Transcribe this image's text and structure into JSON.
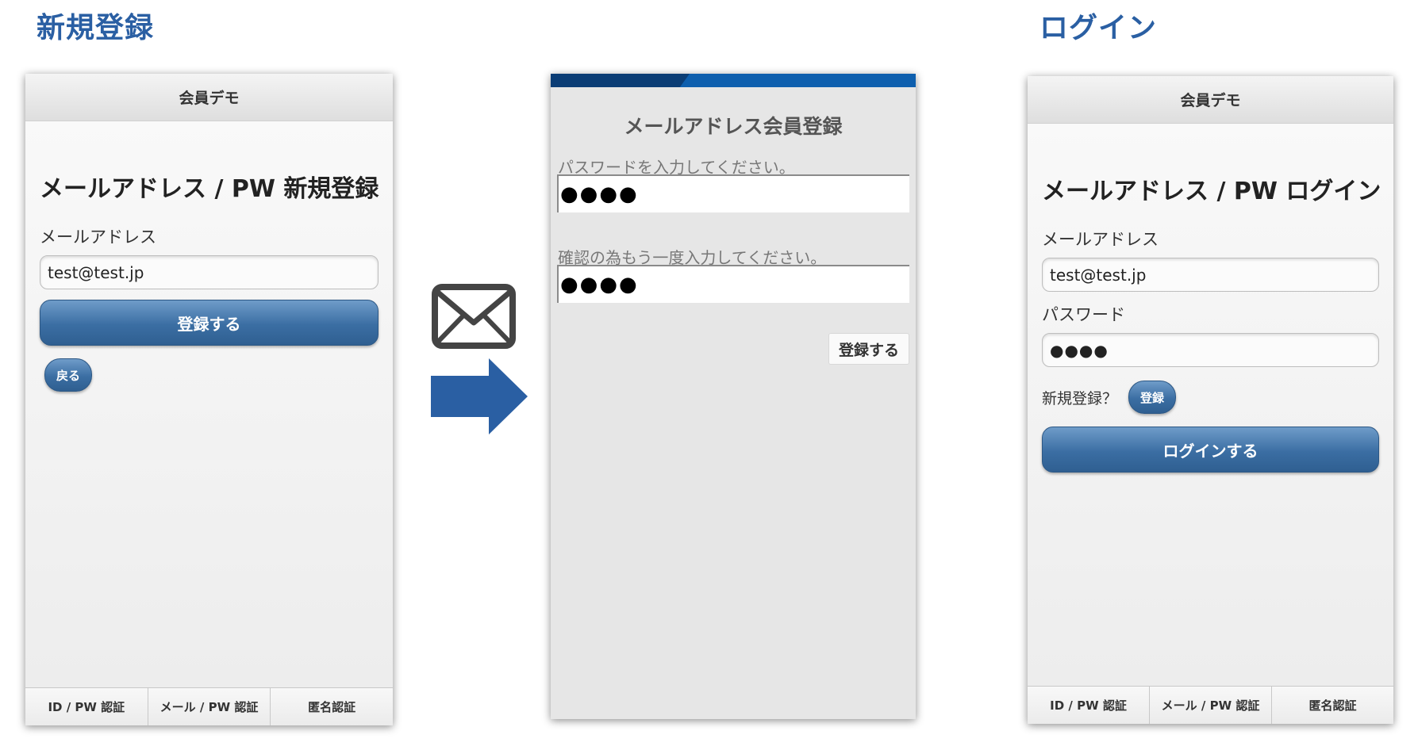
{
  "sections": {
    "register_title": "新規登録",
    "login_title": "ログイン"
  },
  "colors": {
    "accent_blue": "#2a5fa3",
    "button_blue": "#3b6ea3",
    "arrow_blue": "#2a5fa3"
  },
  "register_screen": {
    "header": "会員デモ",
    "heading": "メールアドレス / PW 新規登録",
    "email_label": "メールアドレス",
    "email_value": "test@test.jp",
    "submit_label": "登録する",
    "back_label": "戻る",
    "tabs": [
      "ID / PW 認証",
      "メール / PW 認証",
      "匿名認証"
    ]
  },
  "flow": {
    "icons": [
      "envelope-icon",
      "arrow-right-icon"
    ]
  },
  "confirm_screen": {
    "title": "メールアドレス会員登録",
    "password_label": "パスワードを入力してください。",
    "password_value": "●●●●",
    "confirm_label": "確認の為もう一度入力してください。",
    "confirm_value": "●●●●",
    "submit_label": "登録する"
  },
  "login_screen": {
    "header": "会員デモ",
    "heading": "メールアドレス / PW ログイン",
    "email_label": "メールアドレス",
    "email_value": "test@test.jp",
    "password_label": "パスワード",
    "password_value": "●●●●",
    "register_prompt": "新規登録？",
    "register_button": "登録",
    "submit_label": "ログインする",
    "tabs": [
      "ID / PW 認証",
      "メール / PW 認証",
      "匿名認証"
    ]
  }
}
